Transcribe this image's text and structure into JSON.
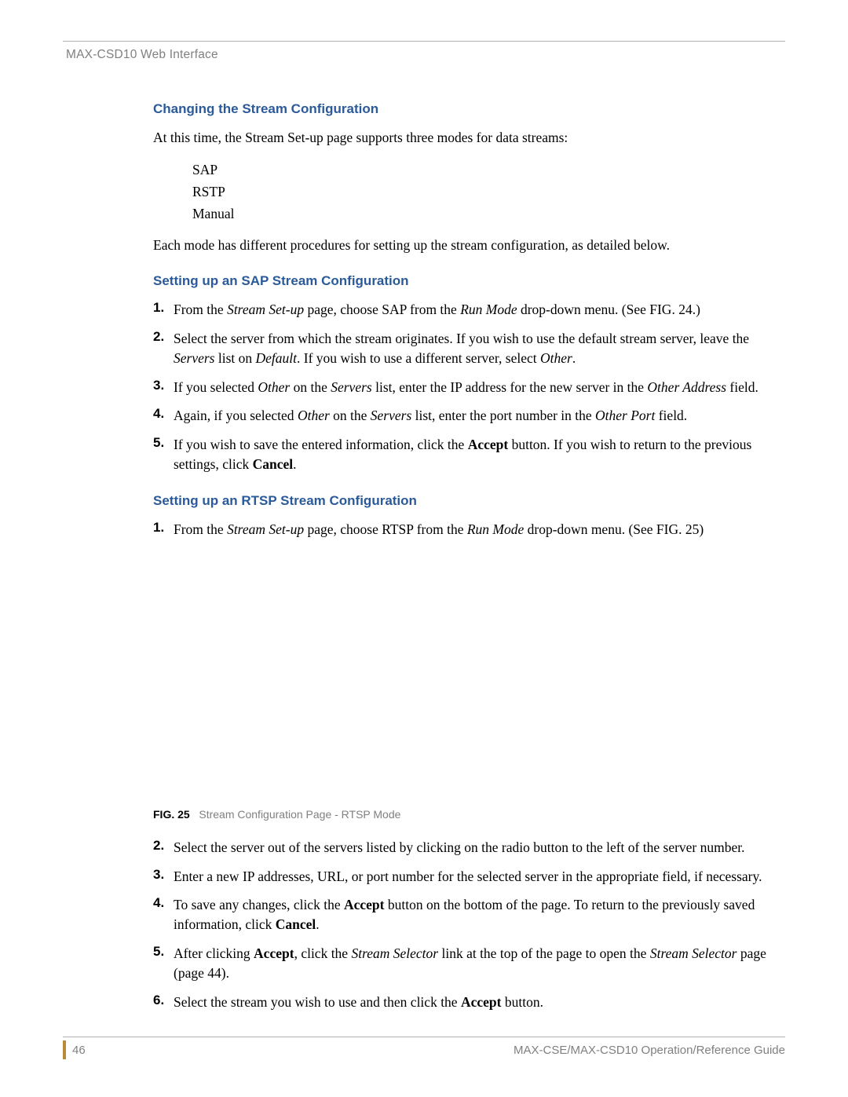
{
  "header": {
    "chapter": "MAX-CSD10 Web Interface"
  },
  "section1": {
    "heading": "Changing the Stream Configuration",
    "intro": "At this time, the Stream Set-up page supports three modes for data streams:",
    "modes": [
      "SAP",
      "RSTP",
      "Manual"
    ],
    "outro": "Each mode has different procedures for setting up the stream configuration, as detailed below."
  },
  "section2": {
    "heading": "Setting up an SAP Stream Configuration",
    "steps": [
      {
        "n": "1.",
        "parts": [
          "From the ",
          {
            "i": "Stream Set-up"
          },
          " page, choose SAP from the ",
          {
            "i": "Run Mode"
          },
          " drop-down menu. (See FIG. 24.)"
        ]
      },
      {
        "n": "2.",
        "parts": [
          "Select the server from which the stream originates. If you wish to use the default stream server, leave the ",
          {
            "i": "Servers"
          },
          " list on ",
          {
            "i": "Default"
          },
          ". If you wish to use a different server, select ",
          {
            "i": "Other"
          },
          "."
        ]
      },
      {
        "n": "3.",
        "parts": [
          "If you selected ",
          {
            "i": "Other"
          },
          " on the ",
          {
            "i": "Servers"
          },
          " list, enter the IP address for the new server in the ",
          {
            "i": "Other Address"
          },
          " field."
        ]
      },
      {
        "n": "4.",
        "parts": [
          "Again, if you selected ",
          {
            "i": "Other"
          },
          " on the ",
          {
            "i": "Servers"
          },
          " list, enter the port number in the ",
          {
            "i": "Other Port"
          },
          " field."
        ]
      },
      {
        "n": "5.",
        "parts": [
          "If you wish to save the entered information, click the ",
          {
            "b": "Accept"
          },
          " button. If you wish to return to the previous settings, click ",
          {
            "b": "Cancel"
          },
          "."
        ]
      }
    ]
  },
  "section3": {
    "heading": "Setting up an RTSP Stream Configuration",
    "stepsA": [
      {
        "n": "1.",
        "parts": [
          "From the ",
          {
            "i": "Stream Set-up"
          },
          " page, choose RTSP from the ",
          {
            "i": "Run Mode"
          },
          " drop-down menu. (See FIG. 25)"
        ]
      }
    ],
    "figure": {
      "label": "FIG. 25",
      "caption": "Stream Configuration Page - RTSP Mode"
    },
    "stepsB": [
      {
        "n": "2.",
        "parts": [
          "Select the server out of the servers listed by clicking on the radio button to the left of the server number."
        ]
      },
      {
        "n": "3.",
        "parts": [
          "Enter a new IP addresses, URL, or port number for the selected server in the appropriate field, if necessary."
        ]
      },
      {
        "n": "4.",
        "parts": [
          "To save any changes, click the ",
          {
            "b": "Accept"
          },
          " button on the bottom of the page. To return to the previously saved information, click ",
          {
            "b": "Cancel"
          },
          "."
        ]
      },
      {
        "n": "5.",
        "parts": [
          "After clicking ",
          {
            "b": "Accept"
          },
          ", click the ",
          {
            "i": "Stream Selector"
          },
          " link at the top of the page to open the ",
          {
            "i": "Stream Selector"
          },
          " page (page 44)."
        ]
      },
      {
        "n": "6.",
        "parts": [
          "Select the stream you wish to use and then click the ",
          {
            "b": "Accept"
          },
          " button."
        ]
      }
    ]
  },
  "footer": {
    "page": "46",
    "title": "MAX-CSE/MAX-CSD10 Operation/Reference Guide"
  }
}
